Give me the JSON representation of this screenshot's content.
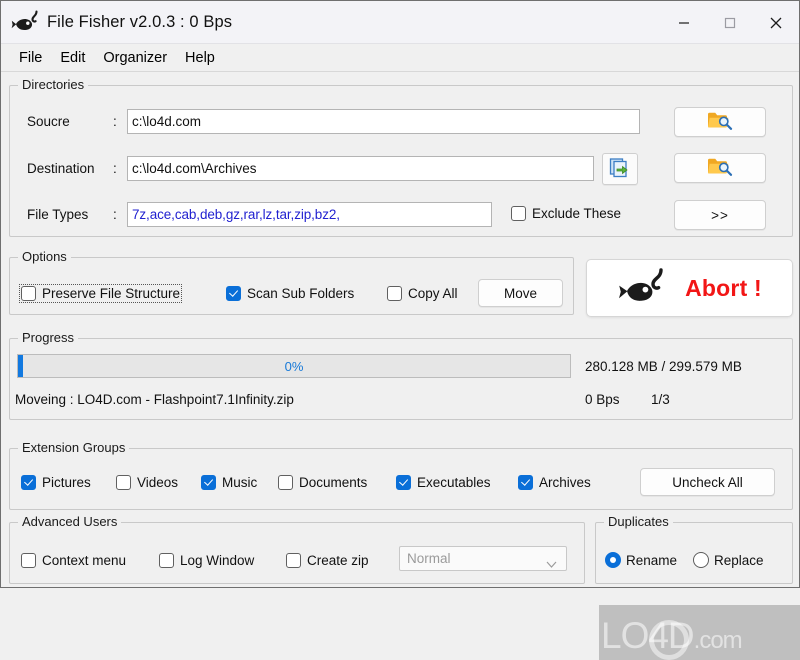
{
  "window": {
    "title": "File Fisher v2.0.3 : 0 Bps",
    "app_icon": "fish-hook-icon",
    "minimize_label": "–",
    "maximize_label": "□",
    "close_label": "✕"
  },
  "menubar": {
    "items": [
      {
        "label": "File"
      },
      {
        "label": "Edit"
      },
      {
        "label": "Organizer"
      },
      {
        "label": "Help"
      }
    ]
  },
  "directories": {
    "legend": "Directories",
    "source": {
      "label": "Soucre",
      "colon": ":",
      "value": "c:\\lo4d.com",
      "browse_icon": "folder-search-icon"
    },
    "destination": {
      "label": "Destination",
      "colon": ":",
      "value": "c:\\lo4d.com\\Archives",
      "swap_icon": "copy-pages-arrow-icon",
      "browse_icon": "folder-search-icon"
    },
    "file_types": {
      "label": "File Types",
      "colon": ":",
      "value": "7z,ace,cab,deb,gz,rar,lz,tar,zip,bz2,",
      "text_color": "#1f1fd0",
      "exclude_label": "Exclude These",
      "exclude_checked": false,
      "more_button": ">>"
    }
  },
  "options": {
    "legend": "Options",
    "checkboxes": [
      {
        "label": "Preserve File Structure",
        "checked": false,
        "focused": true
      },
      {
        "label": "Scan Sub Folders",
        "checked": true,
        "focused": false
      },
      {
        "label": "Copy All",
        "checked": false,
        "focused": false
      }
    ],
    "move_button": "Move"
  },
  "abort": {
    "label": "Abort !",
    "icon": "fish-hook-icon",
    "color": "#f21616"
  },
  "progress": {
    "legend": "Progress",
    "percent_label": "0%",
    "percent_value": 0,
    "size_label": "280.128 MB / 299.579 MB",
    "status_label": "Moveing : LO4D.com - Flashpoint7.1Infinity.zip",
    "speed_label": "0 Bps",
    "count_label": "1/3"
  },
  "extension_groups": {
    "legend": "Extension Groups",
    "items": [
      {
        "label": "Pictures",
        "checked": true
      },
      {
        "label": "Videos",
        "checked": false
      },
      {
        "label": "Music",
        "checked": true
      },
      {
        "label": "Documents",
        "checked": false
      },
      {
        "label": "Executables",
        "checked": true
      },
      {
        "label": "Archives",
        "checked": true
      }
    ],
    "uncheck_all_button": "Uncheck All"
  },
  "advanced_users": {
    "legend": "Advanced Users",
    "checkboxes": [
      {
        "label": "Context menu",
        "checked": false
      },
      {
        "label": "Log Window",
        "checked": false
      },
      {
        "label": "Create zip",
        "checked": false
      }
    ],
    "zip_level_value": "Normal"
  },
  "duplicates": {
    "legend": "Duplicates",
    "options": [
      {
        "label": "Rename",
        "selected": true
      },
      {
        "label": "Replace",
        "selected": false
      }
    ]
  },
  "watermark": {
    "text": "LO4D",
    "suffix": ".com"
  }
}
